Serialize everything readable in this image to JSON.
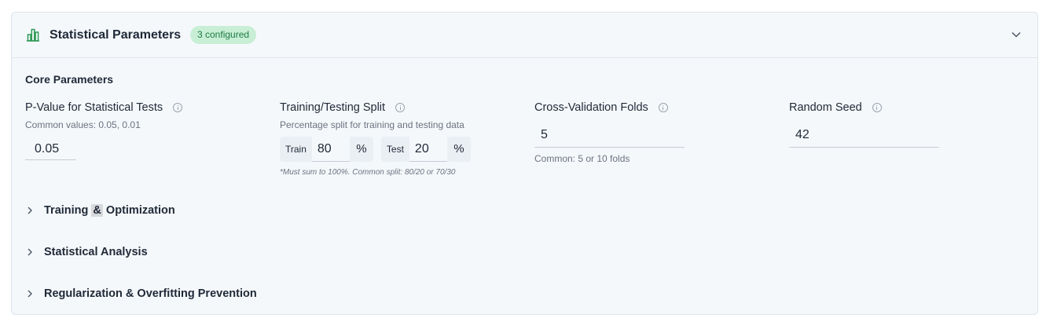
{
  "panel": {
    "title": "Statistical Parameters",
    "badge": "3 configured",
    "accent_color": "#2e9a55"
  },
  "core": {
    "heading": "Core Parameters",
    "pvalue": {
      "label": "P-Value for Statistical Tests",
      "help": "Common values: 0.05, 0.01",
      "value": "0.05"
    },
    "split": {
      "label": "Training/Testing Split",
      "help": "Percentage split for training and testing data",
      "train_prefix": "Train",
      "train_value": "80",
      "train_suffix": "%",
      "test_prefix": "Test",
      "test_value": "20",
      "test_suffix": "%",
      "note": "*Must sum to 100%. Common split: 80/20 or 70/30"
    },
    "cv": {
      "label": "Cross-Validation Folds",
      "value": "5",
      "help": "Common: 5 or 10 folds"
    },
    "seed": {
      "label": "Random Seed",
      "value": "42"
    }
  },
  "sections": {
    "training": {
      "label_a": "Training ",
      "label_amp": "&",
      "label_b": " Optimization"
    },
    "analysis": {
      "label": "Statistical Analysis"
    },
    "regularization": {
      "label": "Regularization & Overfitting Prevention"
    }
  }
}
